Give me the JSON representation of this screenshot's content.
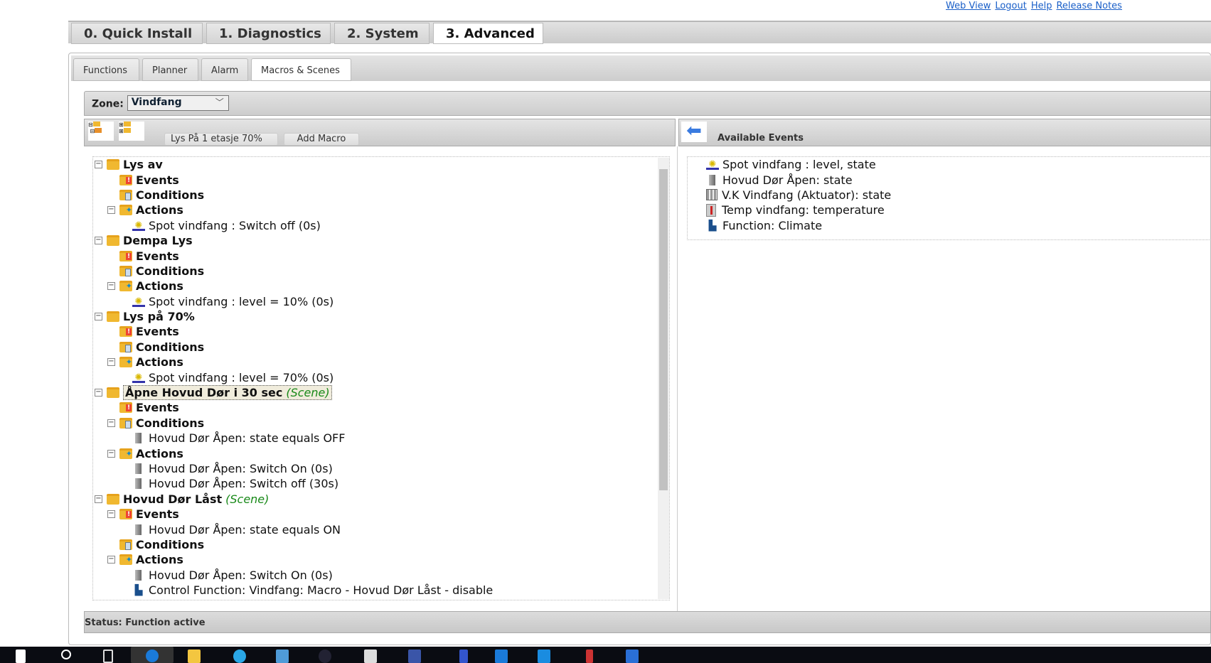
{
  "top_links": [
    "Web View",
    "Logout",
    "Help",
    "Release Notes"
  ],
  "main_tabs": [
    {
      "label": "0. Quick Install"
    },
    {
      "label": "1. Diagnostics"
    },
    {
      "label": "2. System"
    },
    {
      "label": "3. Advanced",
      "active": true
    }
  ],
  "sub_tabs": [
    {
      "label": "Functions"
    },
    {
      "label": "Planner"
    },
    {
      "label": "Alarm"
    },
    {
      "label": "Macros & Scenes",
      "active": true
    }
  ],
  "zone": {
    "label": "Zone:",
    "value": "Vindfang"
  },
  "toolbar": {
    "macro_name": "Lys På 1 etasje 70%",
    "add_macro": "Add Macro",
    "available_events": "Available Events"
  },
  "tree": [
    {
      "level": 0,
      "toggle": "-",
      "icon": "folder",
      "text": "Lys av"
    },
    {
      "level": 1,
      "icon": "events",
      "text": "Events"
    },
    {
      "level": 1,
      "icon": "conditions",
      "text": "Conditions"
    },
    {
      "level": 1,
      "toggle": "-",
      "icon": "actions",
      "text": "Actions"
    },
    {
      "level": 2,
      "icon": "bulb",
      "text": "Spot vindfang : Switch off (0s)"
    },
    {
      "level": 0,
      "toggle": "-",
      "icon": "folder",
      "text": "Dempa Lys"
    },
    {
      "level": 1,
      "icon": "events",
      "text": "Events"
    },
    {
      "level": 1,
      "icon": "conditions",
      "text": "Conditions"
    },
    {
      "level": 1,
      "toggle": "-",
      "icon": "actions",
      "text": "Actions"
    },
    {
      "level": 2,
      "icon": "bulb",
      "text": "Spot vindfang : level = 10% (0s)"
    },
    {
      "level": 0,
      "toggle": "-",
      "icon": "folder",
      "text": "Lys på 70%"
    },
    {
      "level": 1,
      "icon": "events",
      "text": "Events"
    },
    {
      "level": 1,
      "icon": "conditions",
      "text": "Conditions"
    },
    {
      "level": 1,
      "toggle": "-",
      "icon": "actions",
      "text": "Actions"
    },
    {
      "level": 2,
      "icon": "bulb",
      "text": "Spot vindfang : level = 70% (0s)"
    },
    {
      "level": 0,
      "toggle": "-",
      "icon": "folder",
      "text": "Åpne Hovud Dør i 30 sec",
      "tag": "(Scene)",
      "selected": true
    },
    {
      "level": 1,
      "icon": "events",
      "text": "Events"
    },
    {
      "level": 1,
      "toggle": "-",
      "icon": "conditions",
      "text": "Conditions"
    },
    {
      "level": 2,
      "icon": "door",
      "text": "Hovud Dør Åpen: state equals OFF"
    },
    {
      "level": 1,
      "toggle": "-",
      "icon": "actions",
      "text": "Actions"
    },
    {
      "level": 2,
      "icon": "door",
      "text": "Hovud Dør Åpen: Switch On (0s)"
    },
    {
      "level": 2,
      "icon": "door",
      "text": "Hovud Dør Åpen: Switch off (30s)"
    },
    {
      "level": 0,
      "toggle": "-",
      "icon": "folder",
      "text": "Hovud Dør Låst",
      "tag": "(Scene)"
    },
    {
      "level": 1,
      "toggle": "-",
      "icon": "events",
      "text": "Events"
    },
    {
      "level": 2,
      "icon": "door",
      "text": "Hovud Dør Åpen: state equals ON"
    },
    {
      "level": 1,
      "icon": "conditions",
      "text": "Conditions"
    },
    {
      "level": 1,
      "toggle": "-",
      "icon": "actions",
      "text": "Actions"
    },
    {
      "level": 2,
      "icon": "door",
      "text": "Hovud Dør Åpen: Switch On (0s)"
    },
    {
      "level": 2,
      "icon": "house",
      "text": "Control Function: Vindfang: Macro - Hovud Dør Låst - disable"
    }
  ],
  "available_events": [
    {
      "icon": "bulb",
      "text": "Spot vindfang : level, state"
    },
    {
      "icon": "door",
      "text": "Hovud Dør Åpen: state"
    },
    {
      "icon": "actuator",
      "text": "V.K Vindfang (Aktuator): state"
    },
    {
      "icon": "thermometer",
      "text": "Temp vindfang: temperature"
    },
    {
      "icon": "house",
      "text": "Function: Climate"
    }
  ],
  "status": "Status: Function active"
}
